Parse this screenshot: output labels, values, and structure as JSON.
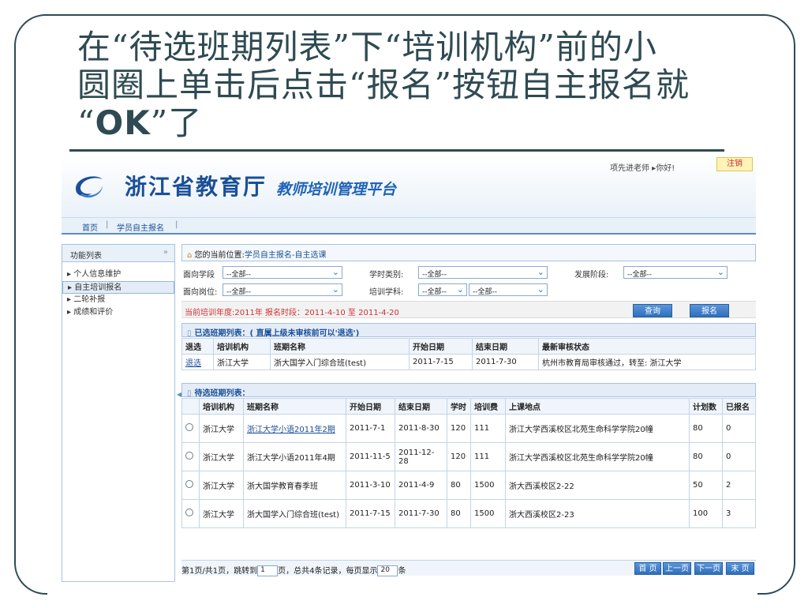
{
  "slide": {
    "title_line1": "在“待选班期列表”下“培训机构”前的小",
    "title_line2": "圆圈上单击后点击“报名”按钮自主报名就",
    "title_q1": "“",
    "title_ok": "OK",
    "title_q2": "”了"
  },
  "header": {
    "logo_text": "浙江省教育厅",
    "platform_text": "教师培训管理平台",
    "user_text": "项先进老师 ▸你好!",
    "logout_label": "注销"
  },
  "nav": {
    "home": "首页",
    "self_enroll": "学员自主报名"
  },
  "sidebar": {
    "header": "功能列表",
    "items": [
      {
        "label": "个人信息维护"
      },
      {
        "label": "自主培训报名"
      },
      {
        "label": "二轮补报"
      },
      {
        "label": "成绩和评价"
      }
    ]
  },
  "breadcrumb": {
    "prefix": "您的当前位置:",
    "path": "学员自主报名-自主选课"
  },
  "filters": {
    "grade_label": "面向学段",
    "grade_value": "--全部--",
    "hour_type_label": "学时类别:",
    "hour_type_value": "--全部--",
    "stage_label": "发展阶段:",
    "stage_value": "--全部--",
    "post_label": "面向岗位:",
    "post_value": "--全部--",
    "subject_label": "培训学科:",
    "subject_value1": "--全部--",
    "subject_value2": "--全部--"
  },
  "period": {
    "text": "当前培训年度:2011年   报名时段：2011-4-10 至 2011-4-20"
  },
  "buttons": {
    "query": "查询",
    "enroll": "报名"
  },
  "selected": {
    "title": "已选班期列表：( 直属上级未审核前可以'退选')",
    "headers": [
      "退选",
      "培训机构",
      "班期名称",
      "开始日期",
      "结束日期",
      "最新审核状态"
    ],
    "rows": [
      {
        "action": "退选",
        "org": "浙江大学",
        "name": "浙大国学入门综合班(test)",
        "start": "2011-7-15",
        "end": "2011-7-30",
        "status": "杭州市教育局审核通过，转至: 浙江大学"
      }
    ]
  },
  "pending": {
    "title": "待选班期列表：",
    "headers": [
      "",
      "培训机构",
      "班期名称",
      "开始日期",
      "结束日期",
      "学时",
      "培训费",
      "上课地点",
      "计划数",
      "已报名"
    ],
    "rows": [
      {
        "org": "浙江大学",
        "name": "浙江大学小语2011年2期",
        "start": "2011-7-1",
        "end": "2011-8-30",
        "hours": "120",
        "fee": "111",
        "place": "浙江大学西溪校区北苑生命科学学院20幢",
        "plan": "80",
        "enrolled": "0"
      },
      {
        "org": "浙江大学",
        "name": "浙江大学小语2011年4期",
        "start": "2011-11-5",
        "end": "2011-12-28",
        "hours": "120",
        "fee": "111",
        "place": "浙江大学西溪校区北苑生命科学学院20幢",
        "plan": "80",
        "enrolled": "0"
      },
      {
        "org": "浙江大学",
        "name": "浙大国学教育春季班",
        "start": "2011-3-10",
        "end": "2011-4-9",
        "hours": "80",
        "fee": "1500",
        "place": "浙大西溪校区2-22",
        "plan": "50",
        "enrolled": "2"
      },
      {
        "org": "浙江大学",
        "name": "浙大国学入门综合班(test)",
        "start": "2011-7-15",
        "end": "2011-7-30",
        "hours": "80",
        "fee": "1500",
        "place": "浙大西溪校区2-23",
        "plan": "100",
        "enrolled": "3"
      }
    ]
  },
  "pager": {
    "text1": "第1页/共1页，跳转到",
    "page_value": "1",
    "text2": "页，总共4条记录，每页显示",
    "per_page_value": "20",
    "text3": "条",
    "first": "首 页",
    "prev": "上一页",
    "next": "下一页",
    "last": "末 页"
  }
}
